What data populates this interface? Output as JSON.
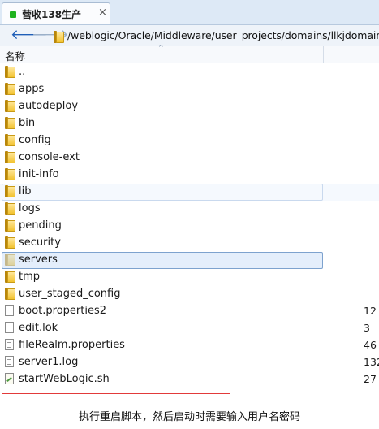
{
  "tab": {
    "title": "营收138生产",
    "close": "×",
    "status_color": "#1fb21f"
  },
  "address_bar": {
    "back": "🡐",
    "forward": "🡒",
    "path": "/weblogic/Oracle/Middleware/user_projects/domains/llkjdomain"
  },
  "columns": {
    "name": "名称",
    "sort_indicator": "^"
  },
  "rows": [
    {
      "name": "..",
      "kind": "folder",
      "size": ""
    },
    {
      "name": "apps",
      "kind": "folder",
      "size": ""
    },
    {
      "name": "autodeploy",
      "kind": "folder",
      "size": ""
    },
    {
      "name": "bin",
      "kind": "folder",
      "size": ""
    },
    {
      "name": "config",
      "kind": "folder",
      "size": ""
    },
    {
      "name": "console-ext",
      "kind": "folder",
      "size": ""
    },
    {
      "name": "init-info",
      "kind": "folder",
      "size": ""
    },
    {
      "name": "lib",
      "kind": "folder",
      "size": ""
    },
    {
      "name": "logs",
      "kind": "folder",
      "size": ""
    },
    {
      "name": "pending",
      "kind": "folder",
      "size": ""
    },
    {
      "name": "security",
      "kind": "folder",
      "size": ""
    },
    {
      "name": "servers",
      "kind": "folder",
      "size": ""
    },
    {
      "name": "tmp",
      "kind": "folder",
      "size": ""
    },
    {
      "name": "user_staged_config",
      "kind": "folder",
      "size": ""
    },
    {
      "name": "boot.properties2",
      "kind": "file",
      "size": "12"
    },
    {
      "name": "edit.lok",
      "kind": "file",
      "size": "3"
    },
    {
      "name": "fileRealm.properties",
      "kind": "file",
      "size": "46"
    },
    {
      "name": "server1.log",
      "kind": "file",
      "size": "132"
    },
    {
      "name": "startWebLogic.sh",
      "kind": "file-sh",
      "size": "27"
    }
  ],
  "caption": "执行重启脚本，然后启动时需要输入用户名密码",
  "annotation_color": "#e23a3a"
}
